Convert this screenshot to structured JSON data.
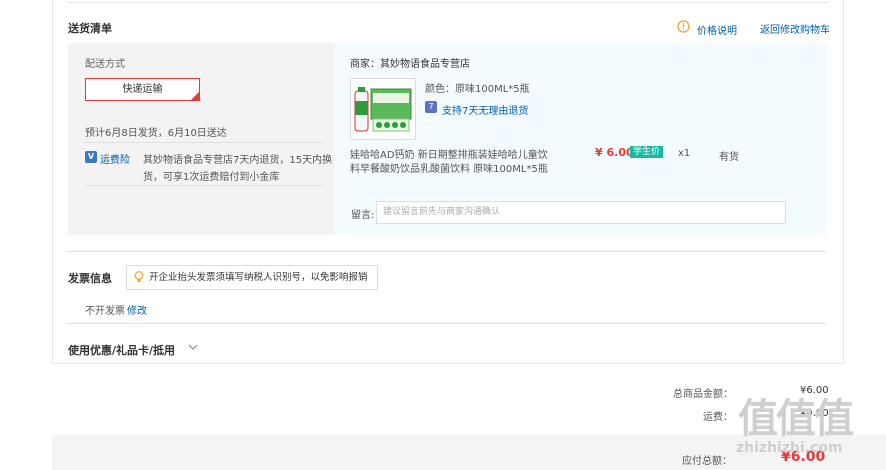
{
  "delivery": {
    "title": "送货清单",
    "price_note": "价格说明",
    "back_to_cart": "返回修改购物车",
    "ship_method_label": "配送方式",
    "ship_method": "快递运输",
    "delivery_estimate": "预计6月8日发货，6月10日送达",
    "insurance_label": "运费险",
    "insurance_text_line1": "其妙物语食品专营店7天内退货，15天内换",
    "insurance_text_line2": "货，可享1次运费赔付到小金库"
  },
  "order": {
    "store": "商家：其妙物语食品专营店",
    "color_spec": "颜色：原味100ML*5瓶",
    "return_policy": "支持7天无理由退货",
    "product_name_line1": "娃哈哈AD钙奶 新日期整排瓶装娃哈哈儿童饮",
    "product_name_line2": "料早餐酸奶饮品乳酸菌饮料 原味100ML*5瓶",
    "price": "¥ 6.00",
    "price_badge": "学生价",
    "quantity": "x1",
    "stock": "有货",
    "message_label": "留言:",
    "message_placeholder": "建议留言前先与商家沟通确认"
  },
  "invoice": {
    "title": "发票信息",
    "tip": "开企业抬头发票须填写纳税人识别号，以免影响报销",
    "status": "不开发票",
    "edit": "修改"
  },
  "coupon": {
    "title": "使用优惠/礼品卡/抵用"
  },
  "summary": {
    "goods_total_label": "总商品金额：",
    "goods_total": "¥6.00",
    "shipping_label": "运费：",
    "shipping": "¥0.00",
    "payable_label": "应付总额：",
    "payable": "¥6.00"
  },
  "watermark": {
    "logo": "值值值",
    "site": "zhizhizhi.com"
  },
  "colors": {
    "accent_red": "#e4393c",
    "link_blue": "#005ea7",
    "badge_green": "#1bb8a4",
    "note_orange": "#f0a020"
  }
}
